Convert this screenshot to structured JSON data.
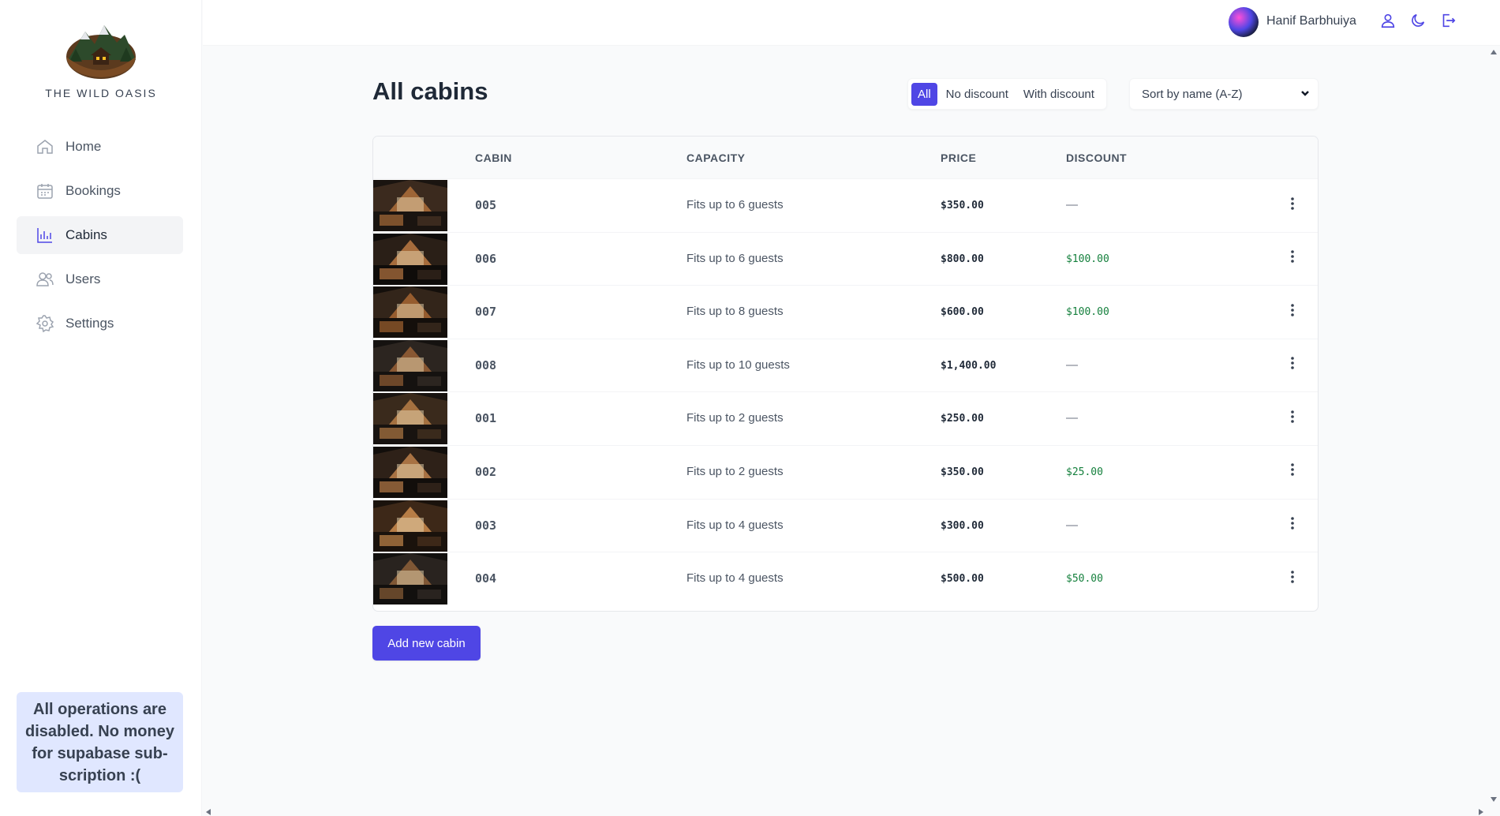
{
  "app": {
    "logo_text": "THE WILD OASIS"
  },
  "sidebar": {
    "items": [
      {
        "label": "Home",
        "icon": "home-icon"
      },
      {
        "label": "Bookings",
        "icon": "calendar-icon"
      },
      {
        "label": "Cabins",
        "icon": "chart-icon",
        "active": true
      },
      {
        "label": "Users",
        "icon": "users-icon"
      },
      {
        "label": "Settings",
        "icon": "gear-icon"
      }
    ],
    "notice": "All operations are disabled. No money for supabase sub-scription :("
  },
  "header": {
    "user_name": "Hanif Barbhuiya",
    "buttons": [
      "user-icon",
      "moon-icon",
      "logout-icon"
    ]
  },
  "main": {
    "title": "All cabins",
    "filters": [
      "All",
      "No discount",
      "With discount"
    ],
    "active_filter": "All",
    "sort": "Sort by name (A-Z)",
    "columns": [
      "Cabin",
      "Capacity",
      "Price",
      "Discount"
    ],
    "rows": [
      {
        "name": "005",
        "capacity": "Fits up to 6 guests",
        "price": "$350.00",
        "discount": "—"
      },
      {
        "name": "006",
        "capacity": "Fits up to 6 guests",
        "price": "$800.00",
        "discount": "$100.00"
      },
      {
        "name": "007",
        "capacity": "Fits up to 8 guests",
        "price": "$600.00",
        "discount": "$100.00"
      },
      {
        "name": "008",
        "capacity": "Fits up to 10 guests",
        "price": "$1,400.00",
        "discount": "—"
      },
      {
        "name": "001",
        "capacity": "Fits up to 2 guests",
        "price": "$250.00",
        "discount": "—"
      },
      {
        "name": "002",
        "capacity": "Fits up to 2 guests",
        "price": "$350.00",
        "discount": "$25.00"
      },
      {
        "name": "003",
        "capacity": "Fits up to 4 guests",
        "price": "$300.00",
        "discount": "—"
      },
      {
        "name": "004",
        "capacity": "Fits up to 4 guests",
        "price": "$500.00",
        "discount": "$50.00"
      }
    ],
    "add_button": "Add new cabin"
  },
  "colors": {
    "brand": "#4f46e5",
    "discount": "#15803d",
    "notice_bg": "#e0e7ff"
  }
}
